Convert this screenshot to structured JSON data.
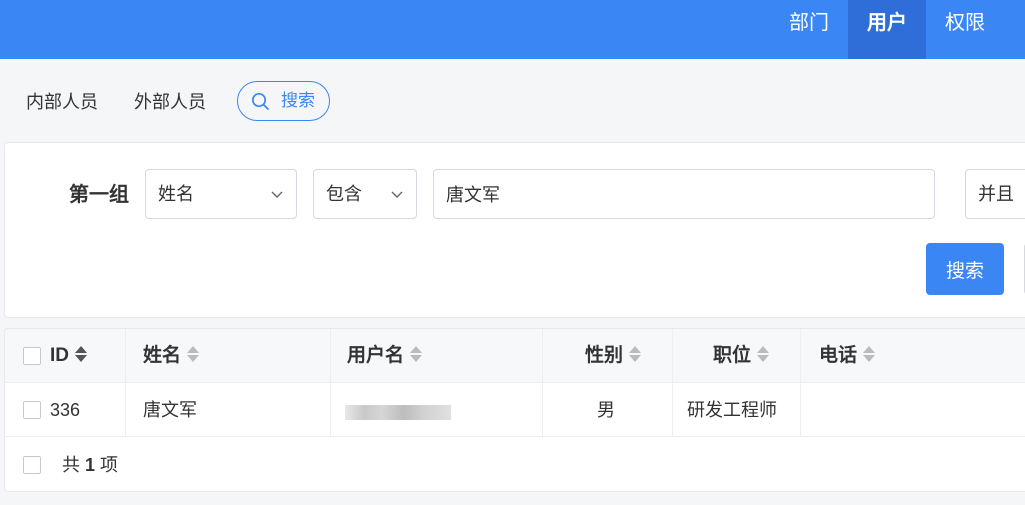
{
  "nav": {
    "items": [
      {
        "label": "部门",
        "active": false
      },
      {
        "label": "用户",
        "active": true
      },
      {
        "label": "权限",
        "active": false
      }
    ],
    "bg_color": "#3a86f4",
    "active_bg_color": "#2f6ed8"
  },
  "subtabs": {
    "internal": "内部人员",
    "external": "外部人员",
    "search_toggle": "搜索",
    "search_icon": "search-icon"
  },
  "filter": {
    "group_label": "第一组",
    "field_select": "姓名",
    "operator_select": "包含",
    "value": "唐文军",
    "logic_select": "并且",
    "search_button": "搜索"
  },
  "table": {
    "columns": [
      {
        "key": "id",
        "label": "ID",
        "sortable": true
      },
      {
        "key": "name",
        "label": "姓名",
        "sortable": true
      },
      {
        "key": "username",
        "label": "用户名",
        "sortable": true
      },
      {
        "key": "gender",
        "label": "性别",
        "sortable": true
      },
      {
        "key": "position",
        "label": "职位",
        "sortable": true
      },
      {
        "key": "phone",
        "label": "电话",
        "sortable": true
      }
    ],
    "rows": [
      {
        "id": "336",
        "name": "唐文军",
        "username": "",
        "username_obscured": true,
        "gender": "男",
        "position": "研发工程师",
        "phone": ""
      }
    ],
    "footer": {
      "prefix": "共",
      "count": "1",
      "suffix": "项"
    }
  },
  "colors": {
    "accent": "#3a86f4",
    "page_bg": "#f5f6f8",
    "header_bg": "#f7f8fa"
  }
}
